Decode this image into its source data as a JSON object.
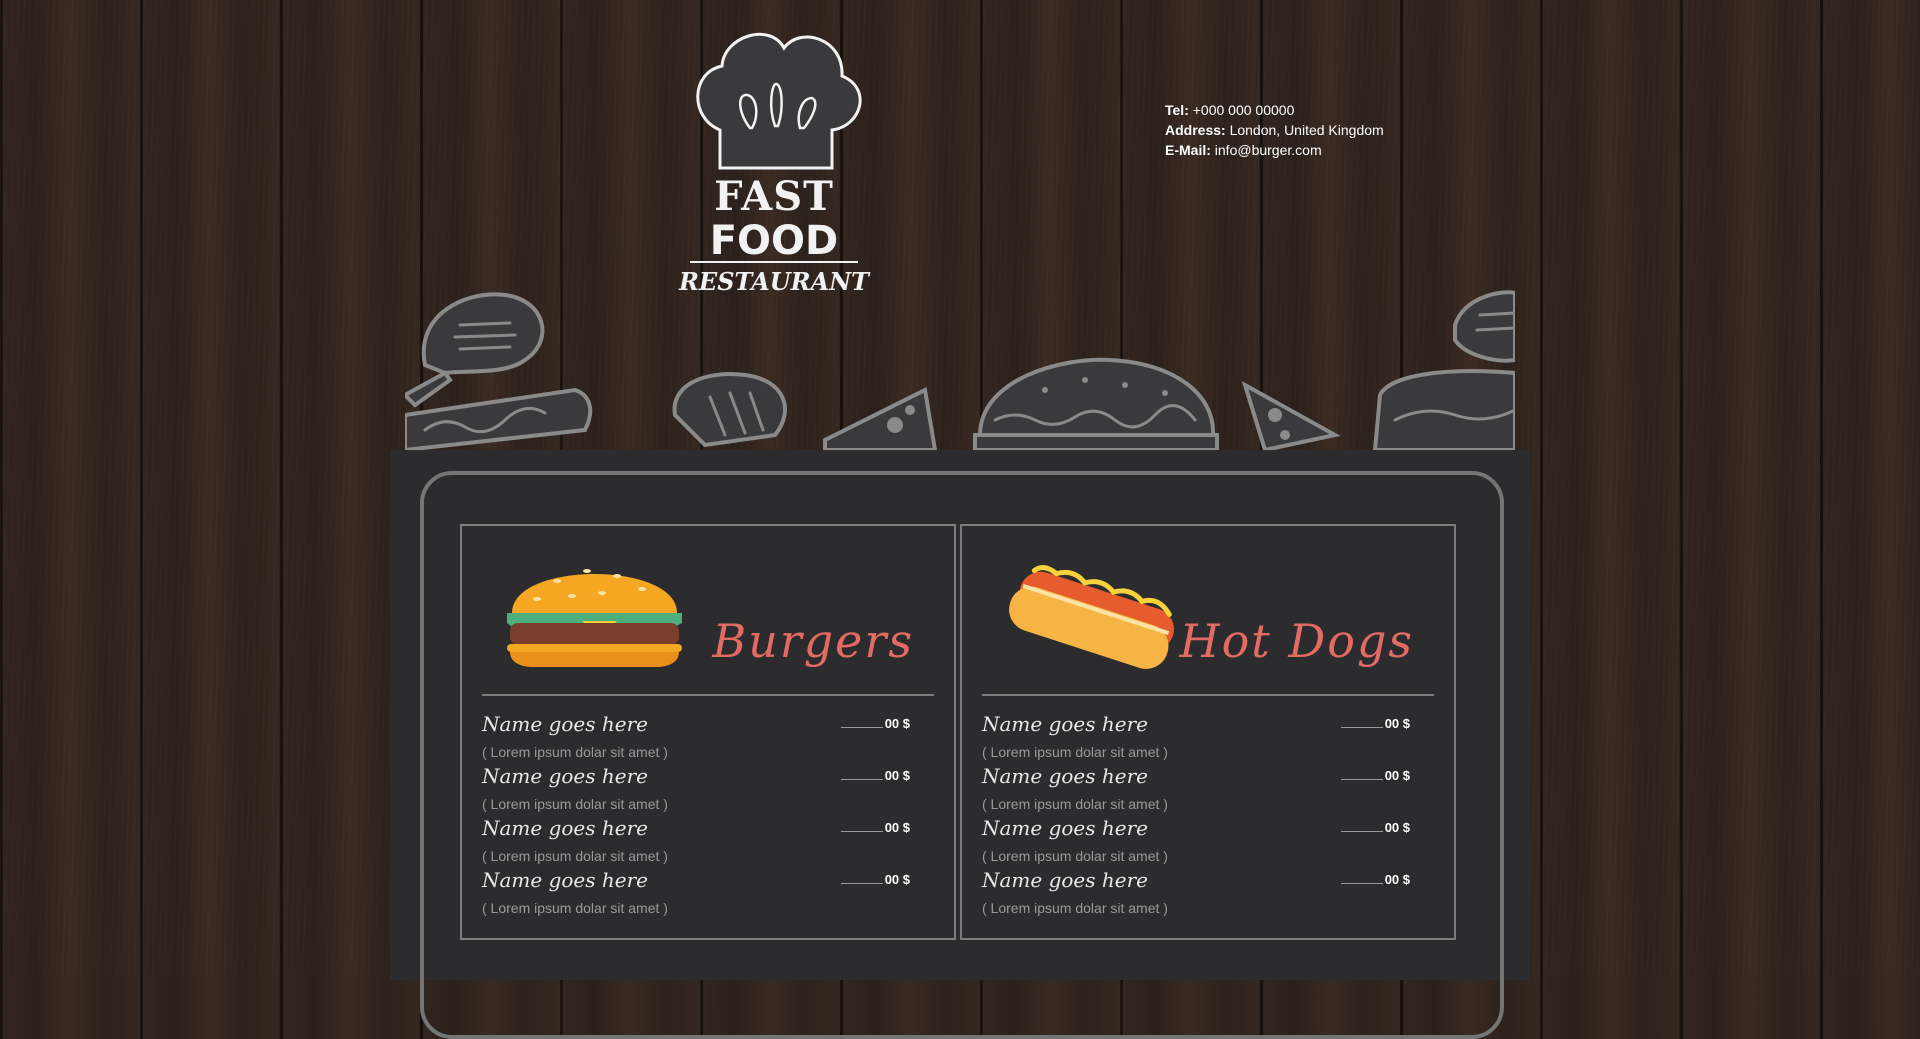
{
  "logo": {
    "line1": "FAST",
    "line2": "FOOD",
    "line3": "RESTAURANT"
  },
  "contact": {
    "tel_label": "Tel:",
    "tel_value": "+000 000 00000",
    "address_label": "Address:",
    "address_value": "London, United Kingdom",
    "email_label": "E-Mail:",
    "email_value": "info@burger.com"
  },
  "colors": {
    "accent": "#e46b64",
    "panel": "#2c2c2e",
    "border": "#7d7d7d"
  },
  "sections": [
    {
      "title": "Burgers",
      "icon": "burger-icon",
      "items": [
        {
          "name": "Name goes here",
          "desc": "( Lorem ipsum dolar sit amet )",
          "price": "00 $"
        },
        {
          "name": "Name goes here",
          "desc": "( Lorem ipsum dolar sit amet )",
          "price": "00 $"
        },
        {
          "name": "Name goes here",
          "desc": "( Lorem ipsum dolar sit amet )",
          "price": "00 $"
        },
        {
          "name": "Name goes here",
          "desc": "( Lorem ipsum dolar sit amet )",
          "price": "00 $"
        }
      ]
    },
    {
      "title": "Hot Dogs",
      "icon": "hotdog-icon",
      "items": [
        {
          "name": "Name goes here",
          "desc": "( Lorem ipsum dolar sit amet )",
          "price": "00 $"
        },
        {
          "name": "Name goes here",
          "desc": "( Lorem ipsum dolar sit amet )",
          "price": "00 $"
        },
        {
          "name": "Name goes here",
          "desc": "( Lorem ipsum dolar sit amet )",
          "price": "00 $"
        },
        {
          "name": "Name goes here",
          "desc": "( Lorem ipsum dolar sit amet )",
          "price": "00 $"
        }
      ]
    }
  ]
}
